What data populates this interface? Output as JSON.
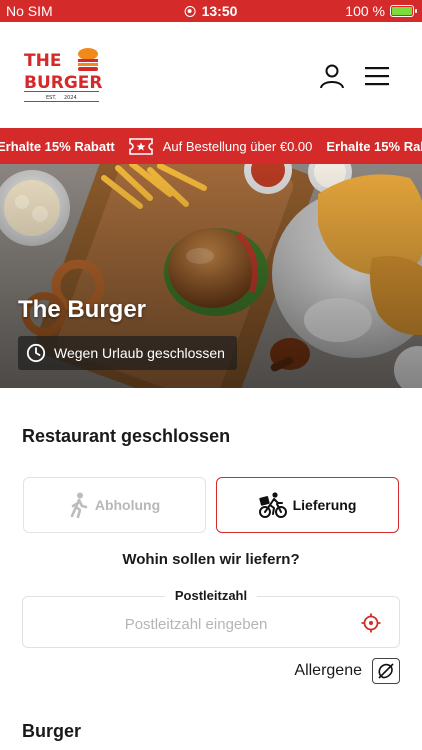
{
  "status_bar": {
    "carrier": "No SIM",
    "time": "13:50",
    "battery": "100 %",
    "battery_level": 1.0
  },
  "header": {
    "logo": {
      "line1": "THE",
      "line2": "BURGER",
      "est": "EST.",
      "year": "2024"
    },
    "icons": {
      "user": "user-icon",
      "menu": "hamburger-menu-icon"
    }
  },
  "promo": {
    "items": [
      "Erhalte 15% Rabatt",
      "Auf Bestellung über €0.00",
      "Erhalte 15% Rabatt"
    ],
    "icon": "ticket-icon"
  },
  "hero": {
    "title": "The Burger",
    "status": "Wegen Urlaub geschlossen",
    "status_icon": "clock-icon"
  },
  "main": {
    "restaurant_status": "Restaurant geschlossen",
    "modes": {
      "pickup": "Abholung",
      "delivery": "Lieferung",
      "selected": "delivery"
    },
    "where_label": "Wohin sollen wir liefern?",
    "zip": {
      "legend": "Postleitzahl",
      "placeholder": "Postleitzahl eingeben",
      "value": ""
    },
    "allergens_label": "Allergene",
    "category_title": "Burger"
  },
  "colors": {
    "brand_red": "#d42a2a",
    "logo_orange": "#f08a1c",
    "disabled_gray": "#b8b8b8"
  }
}
